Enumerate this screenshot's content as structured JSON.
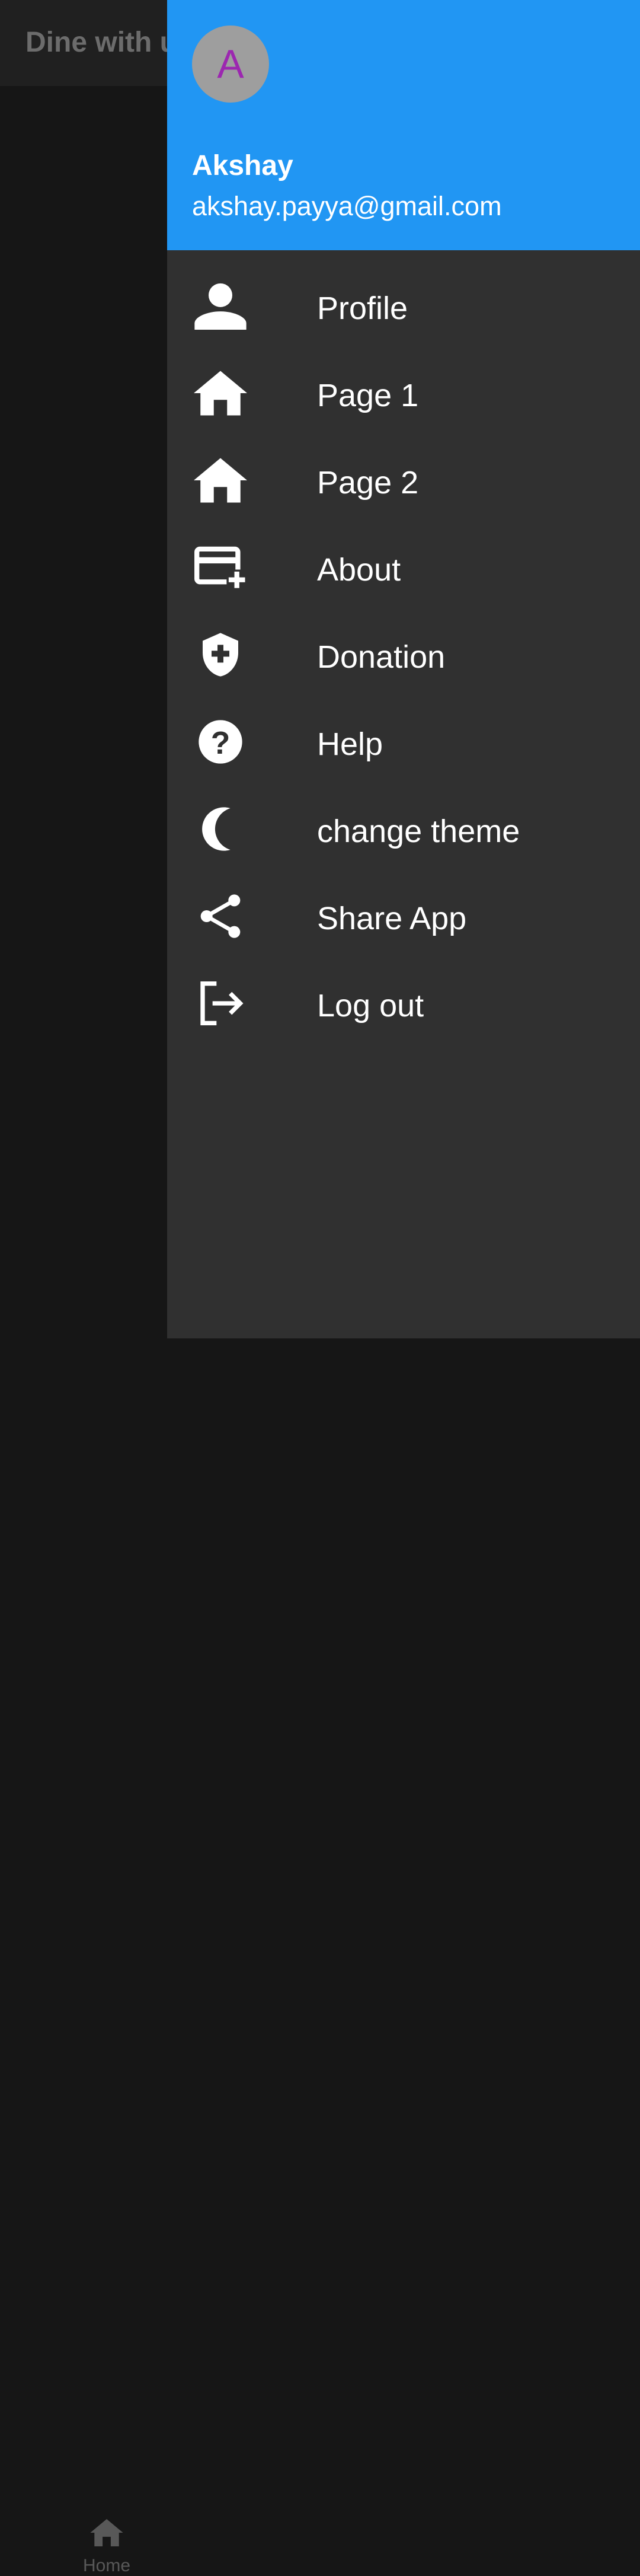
{
  "app": {
    "title": "Dine with us"
  },
  "bottom_nav": {
    "home_label": "Home"
  },
  "drawer": {
    "avatar_letter": "A",
    "user_name": "Akshay",
    "user_email": "akshay.payya@gmail.com",
    "items": [
      {
        "label": "Profile",
        "icon": "person-icon"
      },
      {
        "label": "Page 1",
        "icon": "home-icon"
      },
      {
        "label": "Page 2",
        "icon": "home-icon"
      },
      {
        "label": "About",
        "icon": "add-card-icon"
      },
      {
        "label": "Donation",
        "icon": "medical-shield-icon"
      },
      {
        "label": "Help",
        "icon": "help-icon"
      },
      {
        "label": "change theme",
        "icon": "moon-icon"
      },
      {
        "label": "Share App",
        "icon": "share-icon"
      },
      {
        "label": "Log out",
        "icon": "logout-icon"
      }
    ]
  },
  "colors": {
    "header": "#2196f3",
    "drawer": "#303030",
    "avatar_bg": "#9e9e9e",
    "avatar_letter": "#9c27b0"
  }
}
